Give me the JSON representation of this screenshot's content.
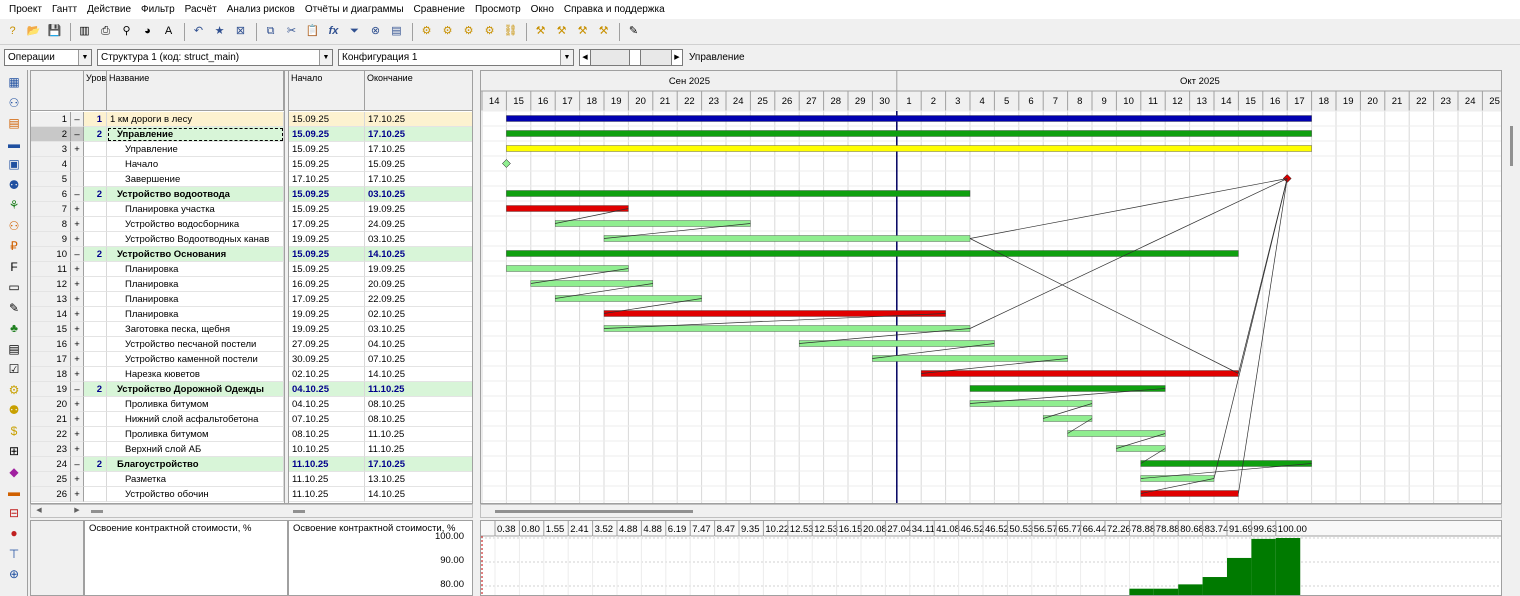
{
  "menu": [
    "Проект",
    "Гантт",
    "Действие",
    "Фильтр",
    "Расчёт",
    "Анализ рисков",
    "Отчёты и диаграммы",
    "Сравнение",
    "Просмотр",
    "Окно",
    "Справка и поддержка"
  ],
  "toolbar": {
    "groups": [
      [
        "help-icon",
        "open-folder-icon",
        "save-icon"
      ],
      [
        "columns-icon",
        "print-icon",
        "filter-funnel-icon",
        "chart-icon",
        "font-icon"
      ],
      [
        "undo-icon",
        "star-icon",
        "export-icon"
      ],
      [
        "copy-icon",
        "cut-icon",
        "paste-icon",
        "formula-icon",
        "filter-icon",
        "delete-icon",
        "table-icon"
      ],
      [
        "resource-1-icon",
        "resource-2-icon",
        "resource-3-icon",
        "resource-4-icon",
        "link-icon"
      ],
      [
        "settings-1-icon",
        "settings-2-icon",
        "settings-3-icon",
        "settings-4-icon"
      ],
      [
        "report-icon"
      ]
    ],
    "formula_glyph": "fx"
  },
  "selectors": {
    "view": "Операции",
    "structure": "Структура 1 (код: struct_main)",
    "configuration": "Конфигурация 1",
    "view_label": "Управление"
  },
  "vtoolbar_icons": [
    "gantt-view-icon",
    "resources-view-icon",
    "stack-view-icon",
    "bars-view-icon",
    "calendar-view-icon",
    "people-view-icon",
    "tree-view-icon",
    "workers-view-icon",
    "cost-view-icon",
    "fsc-icon",
    "doc-icon",
    "doc-edit-icon",
    "tree-icon",
    "doc-list-icon",
    "checklist-icon",
    "resource-yellow-icon",
    "people-yellow-icon",
    "money-yellow-icon",
    "structure-icon",
    "eraser-icon",
    "bars-2-icon",
    "hierarchy-icon",
    "traffic-light-icon",
    "tree-2-icon",
    "money-structure-icon"
  ],
  "table": {
    "headers": {
      "level": "Уровень",
      "name": "Название",
      "start": "Начало",
      "end": "Окончание"
    },
    "rows": [
      {
        "num": "1",
        "exp": "–",
        "lvl": "1",
        "name": "1 км дороги в лесу",
        "start": "15.09.25",
        "end": "17.10.25",
        "kind": "top"
      },
      {
        "num": "2",
        "exp": "–",
        "lvl": "2",
        "name": "Управление",
        "start": "15.09.25",
        "end": "17.10.25",
        "kind": "summary",
        "selected": true
      },
      {
        "num": "3",
        "exp": "+",
        "lvl": "",
        "name": "Управление",
        "start": "15.09.25",
        "end": "17.10.25",
        "kind": "task"
      },
      {
        "num": "4",
        "exp": "",
        "lvl": "",
        "name": "Начало",
        "start": "15.09.25",
        "end": "15.09.25",
        "kind": "task"
      },
      {
        "num": "5",
        "exp": "",
        "lvl": "",
        "name": "Завершение",
        "start": "17.10.25",
        "end": "17.10.25",
        "kind": "task"
      },
      {
        "num": "6",
        "exp": "–",
        "lvl": "2",
        "name": "Устройство водоотвода",
        "start": "15.09.25",
        "end": "03.10.25",
        "kind": "summary"
      },
      {
        "num": "7",
        "exp": "+",
        "lvl": "",
        "name": "Планировка участка",
        "start": "15.09.25",
        "end": "19.09.25",
        "kind": "task"
      },
      {
        "num": "8",
        "exp": "+",
        "lvl": "",
        "name": "Устройство водосборника",
        "start": "17.09.25",
        "end": "24.09.25",
        "kind": "task"
      },
      {
        "num": "9",
        "exp": "+",
        "lvl": "",
        "name": "Устройство Водоотводных канав",
        "start": "19.09.25",
        "end": "03.10.25",
        "kind": "task"
      },
      {
        "num": "10",
        "exp": "–",
        "lvl": "2",
        "name": "Устройство Основания",
        "start": "15.09.25",
        "end": "14.10.25",
        "kind": "summary"
      },
      {
        "num": "11",
        "exp": "+",
        "lvl": "",
        "name": "Планировка",
        "start": "15.09.25",
        "end": "19.09.25",
        "kind": "task"
      },
      {
        "num": "12",
        "exp": "+",
        "lvl": "",
        "name": "Планировка",
        "start": "16.09.25",
        "end": "20.09.25",
        "kind": "task"
      },
      {
        "num": "13",
        "exp": "+",
        "lvl": "",
        "name": "Планировка",
        "start": "17.09.25",
        "end": "22.09.25",
        "kind": "task"
      },
      {
        "num": "14",
        "exp": "+",
        "lvl": "",
        "name": "Планировка",
        "start": "19.09.25",
        "end": "02.10.25",
        "kind": "task"
      },
      {
        "num": "15",
        "exp": "+",
        "lvl": "",
        "name": "Заготовка песка, щебня",
        "start": "19.09.25",
        "end": "03.10.25",
        "kind": "task"
      },
      {
        "num": "16",
        "exp": "+",
        "lvl": "",
        "name": "Устройство песчаной постели",
        "start": "27.09.25",
        "end": "04.10.25",
        "kind": "task"
      },
      {
        "num": "17",
        "exp": "+",
        "lvl": "",
        "name": "Устройство каменной постели",
        "start": "30.09.25",
        "end": "07.10.25",
        "kind": "task"
      },
      {
        "num": "18",
        "exp": "+",
        "lvl": "",
        "name": "Нарезка кюветов",
        "start": "02.10.25",
        "end": "14.10.25",
        "kind": "task"
      },
      {
        "num": "19",
        "exp": "–",
        "lvl": "2",
        "name": "Устройство Дорожной Одежды",
        "start": "04.10.25",
        "end": "11.10.25",
        "kind": "summary"
      },
      {
        "num": "20",
        "exp": "+",
        "lvl": "",
        "name": "Проливка битумом",
        "start": "04.10.25",
        "end": "08.10.25",
        "kind": "task"
      },
      {
        "num": "21",
        "exp": "+",
        "lvl": "",
        "name": "Нижний слой асфальтобетона",
        "start": "07.10.25",
        "end": "08.10.25",
        "kind": "task"
      },
      {
        "num": "22",
        "exp": "+",
        "lvl": "",
        "name": "Проливка битумом",
        "start": "08.10.25",
        "end": "11.10.25",
        "kind": "task"
      },
      {
        "num": "23",
        "exp": "+",
        "lvl": "",
        "name": "Верхний слой АБ",
        "start": "10.10.25",
        "end": "11.10.25",
        "kind": "task"
      },
      {
        "num": "24",
        "exp": "–",
        "lvl": "2",
        "name": "Благоустройство",
        "start": "11.10.25",
        "end": "17.10.25",
        "kind": "summary"
      },
      {
        "num": "25",
        "exp": "+",
        "lvl": "",
        "name": "Разметка",
        "start": "11.10.25",
        "end": "13.10.25",
        "kind": "task"
      },
      {
        "num": "26",
        "exp": "+",
        "lvl": "",
        "name": "Устройство обочин",
        "start": "11.10.25",
        "end": "14.10.25",
        "kind": "task"
      }
    ]
  },
  "gantt": {
    "months": [
      {
        "label": "Сен 2025"
      },
      {
        "label": "Окт 2025"
      }
    ],
    "days": [
      "14",
      "15",
      "16",
      "17",
      "18",
      "19",
      "20",
      "21",
      "22",
      "23",
      "24",
      "25",
      "26",
      "27",
      "28",
      "29",
      "30",
      "1",
      "2",
      "3",
      "4",
      "5",
      "6",
      "7",
      "8",
      "9",
      "10",
      "11",
      "12",
      "13",
      "14",
      "15",
      "16",
      "17",
      "18",
      "19",
      "20",
      "21",
      "22",
      "23",
      "24",
      "25"
    ],
    "first_day": "2025-09-14",
    "today_line_day": "2025-10-01",
    "colors": {
      "top": "#0000b0",
      "summary": "#0fa00f",
      "task_light": "#90ee90",
      "critical": "#e00000",
      "milestone_task": "#ffff00",
      "grid": "#d8d8d8",
      "weekend_line": "#c8c8c8",
      "today": "#000060"
    }
  },
  "bottom": {
    "title": "Освоение контрактной стоимости, %",
    "axis_title": "Освоение контрактной стоимости, %",
    "y_ticks": [
      "100.00",
      "90.00",
      "80.00"
    ],
    "values": [
      "0.38",
      "0.80",
      "1.55",
      "2.41",
      "3.52",
      "4.88",
      "4.88",
      "6.19",
      "7.47",
      "8.47",
      "9.35",
      "10.22",
      "12.53",
      "12.53",
      "16.15",
      "20.08",
      "27.04",
      "34.11",
      "41.08",
      "46.52",
      "46.52",
      "50.53",
      "56.57",
      "65.77",
      "66.44",
      "72.26",
      "78.88",
      "78.88",
      "80.68",
      "83.74",
      "91.69",
      "99.63",
      "100.00"
    ]
  }
}
